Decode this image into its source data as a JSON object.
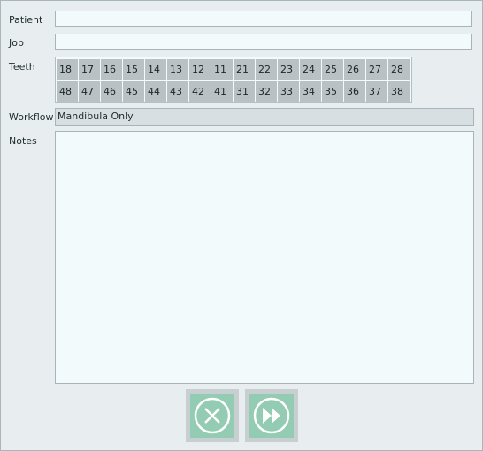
{
  "labels": {
    "patient": "Patient",
    "job": "Job",
    "teeth": "Teeth",
    "workflow": "Workflow",
    "notes": "Notes"
  },
  "fields": {
    "patient_value": "",
    "job_value": "",
    "notes_value": ""
  },
  "teeth": {
    "upper": [
      "18",
      "17",
      "16",
      "15",
      "14",
      "13",
      "12",
      "11",
      "21",
      "22",
      "23",
      "24",
      "25",
      "26",
      "27",
      "28"
    ],
    "lower": [
      "48",
      "47",
      "46",
      "45",
      "44",
      "43",
      "42",
      "41",
      "31",
      "32",
      "33",
      "34",
      "35",
      "36",
      "37",
      "38"
    ]
  },
  "workflow_value": "Mandibula Only",
  "buttons": {
    "cancel_icon": "close-circle-icon",
    "next_icon": "fast-forward-circle-icon"
  },
  "colors": {
    "button_fill": "#93cbb3",
    "tooth_cell": "#b9c1c4",
    "field_bg": "#f3fafc"
  }
}
